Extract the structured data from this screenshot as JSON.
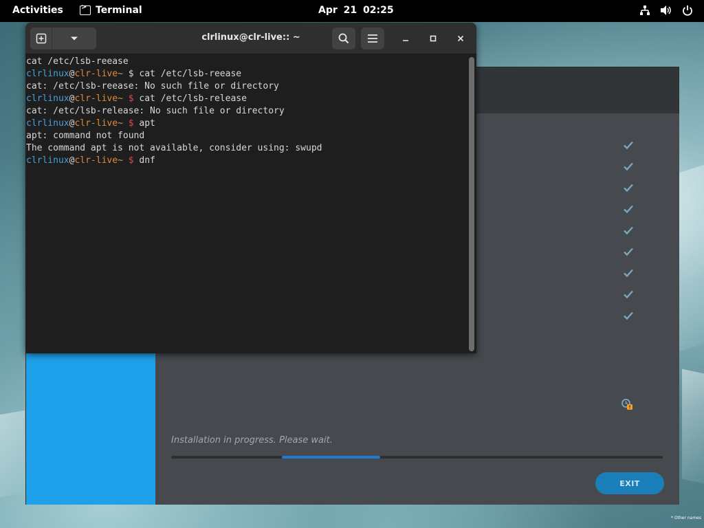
{
  "topbar": {
    "activities": "Activities",
    "app_name": "Terminal",
    "clock": "Apr 21  02:25",
    "tray_icons": [
      "network-icon",
      "volume-icon",
      "power-icon"
    ]
  },
  "desktop": {
    "corner_note": "* Other names"
  },
  "terminal": {
    "title": "clrlinux@clr-live:: ~",
    "lines": [
      {
        "type": "text",
        "text": "cat /etc/lsb-reease"
      },
      {
        "type": "prompt",
        "user": "clrlinux",
        "at": "@",
        "host": "clr-live",
        "tilde": "~",
        "dollar": "$",
        "cmd": "cat /etc/lsb-reease",
        "dollar_red": false
      },
      {
        "type": "text",
        "text": "cat: /etc/lsb-reease: No such file or directory"
      },
      {
        "type": "prompt",
        "user": "clrlinux",
        "at": "@",
        "host": "clr-live",
        "tilde": "~",
        "dollar": "$",
        "cmd": "cat /etc/lsb-release",
        "dollar_red": true
      },
      {
        "type": "text",
        "text": "cat: /etc/lsb-release: No such file or directory"
      },
      {
        "type": "prompt",
        "user": "clrlinux",
        "at": "@",
        "host": "clr-live",
        "tilde": "~",
        "dollar": "$",
        "cmd": "apt",
        "dollar_red": true
      },
      {
        "type": "text",
        "text": "apt: command not found"
      },
      {
        "type": "text",
        "text": "The command apt is not available, consider using: swupd"
      },
      {
        "type": "prompt",
        "user": "clrlinux",
        "at": "@",
        "host": "clr-live",
        "tilde": "~",
        "dollar": "$",
        "cmd": "dnf",
        "dollar_red": true
      }
    ]
  },
  "installer": {
    "status_text": "Installation in progress. Please wait.",
    "progress": {
      "start": 0.225,
      "end": 0.425
    },
    "exit_label": "EXIT",
    "completed_steps": 9,
    "pending_steps": 1,
    "colors": {
      "sidebar": "#1ea1ea",
      "check": "#7aa7bd",
      "progress_fill": "#1f7ad0",
      "exit_button": "#1a7fb8"
    }
  }
}
